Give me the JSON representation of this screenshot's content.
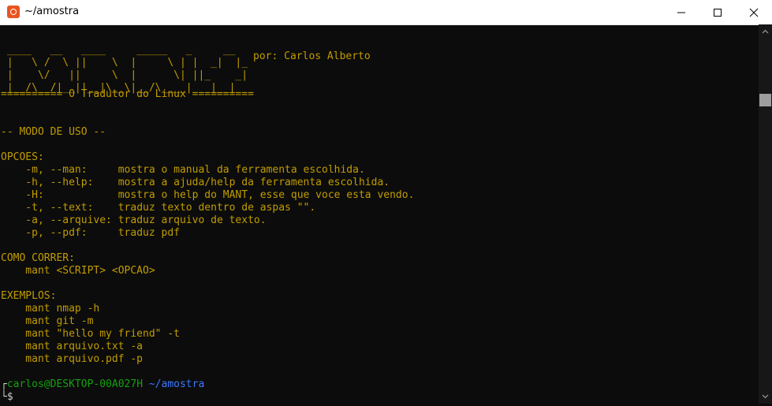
{
  "window": {
    "title": "~/amostra"
  },
  "terminal": {
    "banner": [
      " ____   __   ____     _____   _     __",
      " |   \\ /  \\ ||    \\  |     \\ | |  _|  |_  ",
      " |    \\/   ||     \\  |      \\| ||_    _|",
      " |__/\\__/|__||__|\\__\\|__/\\____|   |__|"
    ],
    "author": "por: Carlos Alberto",
    "subtitle": "========== O Tradutor do Linux ==========",
    "usage_header": "-- MODO DE USO --",
    "options_header": "OPCOES:",
    "options": [
      {
        "flag": "    -m, --man:     ",
        "desc": "mostra o manual da ferramenta escolhida."
      },
      {
        "flag": "    -h, --help:    ",
        "desc": "mostra a ajuda/help da ferramenta escolhida."
      },
      {
        "flag": "    -H:            ",
        "desc": "mostra o help do MANT, esse que voce esta vendo."
      },
      {
        "flag": "    -t, --text:    ",
        "desc": "traduz texto dentro de aspas \"\"."
      },
      {
        "flag": "    -a, --arquive: ",
        "desc": "traduz arquivo de texto."
      },
      {
        "flag": "    -p, --pdf:     ",
        "desc": "traduz pdf"
      }
    ],
    "run_header": "COMO CORRER:",
    "run_usage": "    mant <SCRIPT> <OPCAO>",
    "examples_header": "EXEMPLOS:",
    "examples": [
      "    mant nmap -h",
      "    mant git -m",
      "    mant \"hello my friend\" -t",
      "    mant arquivo.txt -a",
      "    mant arquivo.pdf -p"
    ],
    "prompt": {
      "corner_top": "┌",
      "user_host": "carlos@DESKTOP-00A027H",
      "path": "~/amostra",
      "corner_bottom": "└",
      "symbol": "$"
    }
  },
  "colors": {
    "text": "#c19c00",
    "user": "#13a10e",
    "path": "#3b78ff",
    "background": "#0c0c0c"
  }
}
